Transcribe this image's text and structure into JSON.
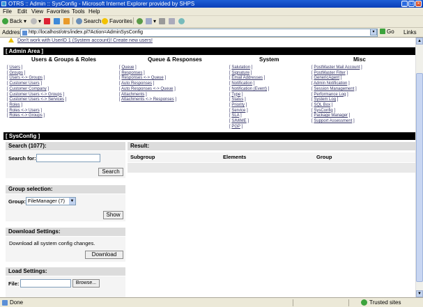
{
  "window": {
    "title": "OTRS :: Admin :: SysConfig - Microsoft Internet Explorer provided by SHPS",
    "min": "_",
    "max": "□",
    "close": "×"
  },
  "menu": [
    "File",
    "Edit",
    "View",
    "Favorites",
    "Tools",
    "Help"
  ],
  "toolbar": {
    "back": "Back",
    "search": "Search",
    "favorites": "Favorites"
  },
  "address": {
    "label": "Address",
    "url": "http://localhost/otrs/index.pl?Action=AdminSysConfig",
    "go": "Go",
    "links": "Links",
    "dropdown": "▾"
  },
  "warning": "Don't work with UserID 1 (System account)! Create new users!",
  "admin": {
    "title": "[ Admin Area ]",
    "columns": [
      {
        "heading": "Users & Groups & Roles",
        "items": [
          "Users",
          "Groups",
          "Users <-> Groups",
          "Customer Users",
          "Customer Company",
          "Customer Users <-> Groups",
          "Customer Users <-> Services",
          "Roles",
          "Roles <-> Users",
          "Roles <-> Groups"
        ]
      },
      {
        "heading": "Queue & Responses",
        "items": [
          "Queue",
          "Responses",
          "Responses <-> Queue",
          "Auto Responses",
          "Auto Responses <-> Queue",
          "Attachments",
          "Attachments <-> Responses"
        ]
      },
      {
        "heading": "System",
        "items": [
          "Salutation",
          "Signature",
          "Email Addresses",
          "Notification",
          "Notification (Event)",
          "Type",
          "Status",
          "Priority",
          "Service",
          "SLA",
          "S/MIME",
          "PGP"
        ]
      },
      {
        "heading": "Misc",
        "items": [
          "PostMaster Mail Account",
          "PostMaster Filter",
          "GenericAgent",
          "Admin Notification",
          "Session Management",
          "Performance Log",
          "System Log",
          "SQL Box",
          "SysConfig",
          "Package Manager",
          "Support Assessment"
        ]
      }
    ]
  },
  "sysconfig": {
    "title": "[ SysConfig ]",
    "search": {
      "head": "Search (1077):",
      "label": "Search for:",
      "value": "",
      "button": "Search"
    },
    "group": {
      "head": "Group selection:",
      "label": "Group:",
      "selected": "FileManager (7)",
      "button": "Show"
    },
    "download": {
      "head": "Download Settings:",
      "text": "Download all system config changes.",
      "button": "Download"
    },
    "load": {
      "head": "Load Settings:",
      "label": "File:",
      "button": "Browse..."
    },
    "result": {
      "head": "Result:",
      "cols": [
        "Subgroup",
        "Elements",
        "Group"
      ]
    }
  },
  "status": {
    "text": "Done",
    "zone": "Trusted sites"
  }
}
